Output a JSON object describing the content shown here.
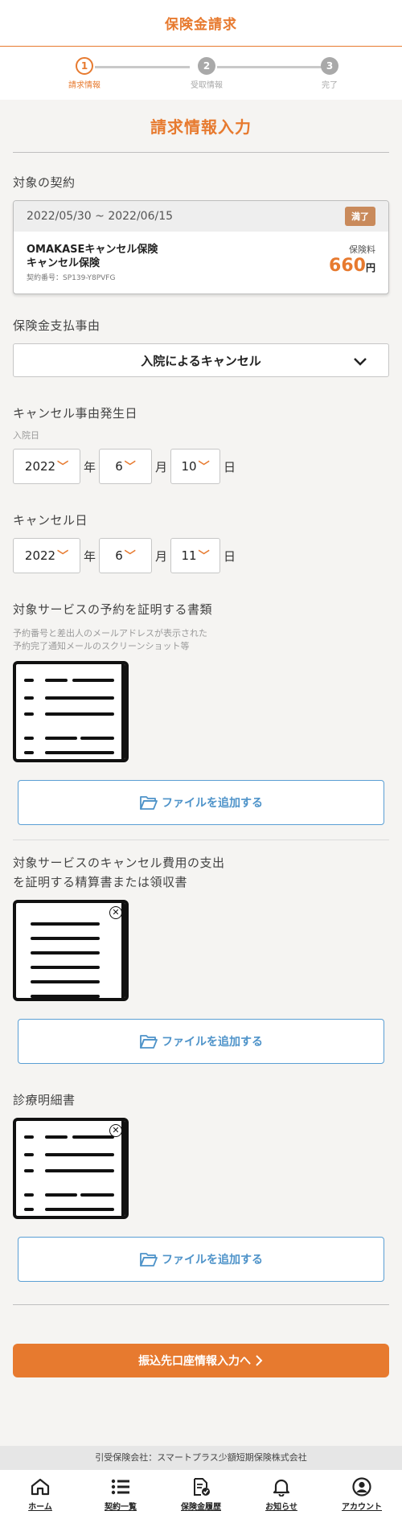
{
  "header": {
    "title": "保険金請求"
  },
  "stepper": [
    {
      "num": "1",
      "label": "請求情報"
    },
    {
      "num": "2",
      "label": "受取情報"
    },
    {
      "num": "3",
      "label": "完了"
    }
  ],
  "section_title": "請求情報入力",
  "contract": {
    "label": "対象の契約",
    "period": "2022/05/30 ~ 2022/06/15",
    "status": "満了",
    "name": "OMAKASEキャンセル保険",
    "plan": "キャンセル保険",
    "number": "契約番号：SP139-Y8PVFG",
    "fee_label": "保険料",
    "fee_value": "660",
    "fee_unit": "円"
  },
  "reason": {
    "label": "保険金支払事由",
    "value": "入院によるキャンセル"
  },
  "event_date": {
    "label": "キャンセル事由発生日",
    "sublabel": "入院日",
    "year": "2022",
    "month": "6",
    "day": "10"
  },
  "cancel_date": {
    "label": "キャンセル日",
    "year": "2022",
    "month": "6",
    "day": "11"
  },
  "units": {
    "year": "年",
    "month": "月",
    "day": "日"
  },
  "docs": {
    "reservation": {
      "label": "対象サービスの予約を証明する書類",
      "note1": "予約番号と差出人のメールアドレスが表示された",
      "note2": "予約完了通知メールのスクリーンショット等"
    },
    "receipt": {
      "label1": "対象サービスのキャンセル費用の支出",
      "label2": "を証明する精算書または領収書"
    },
    "medical": {
      "label": "診療明細書"
    },
    "add_label": "ファイルを追加する",
    "remove_glyph": "✕"
  },
  "submit_label": "振込先口座情報入力へ",
  "footer": {
    "company": "引受保険会社：スマートプラス少額短期保険株式会社"
  },
  "nav": [
    {
      "label": "ホーム",
      "icon": "home-icon"
    },
    {
      "label": "契約一覧",
      "icon": "list-icon"
    },
    {
      "label": "保険金履歴",
      "icon": "claim-history-icon"
    },
    {
      "label": "お知らせ",
      "icon": "bell-icon"
    },
    {
      "label": "アカウント",
      "icon": "account-icon"
    }
  ],
  "colors": {
    "accent": "#e77a2f",
    "link": "#4e93c9",
    "badge": "#c98a5b"
  }
}
